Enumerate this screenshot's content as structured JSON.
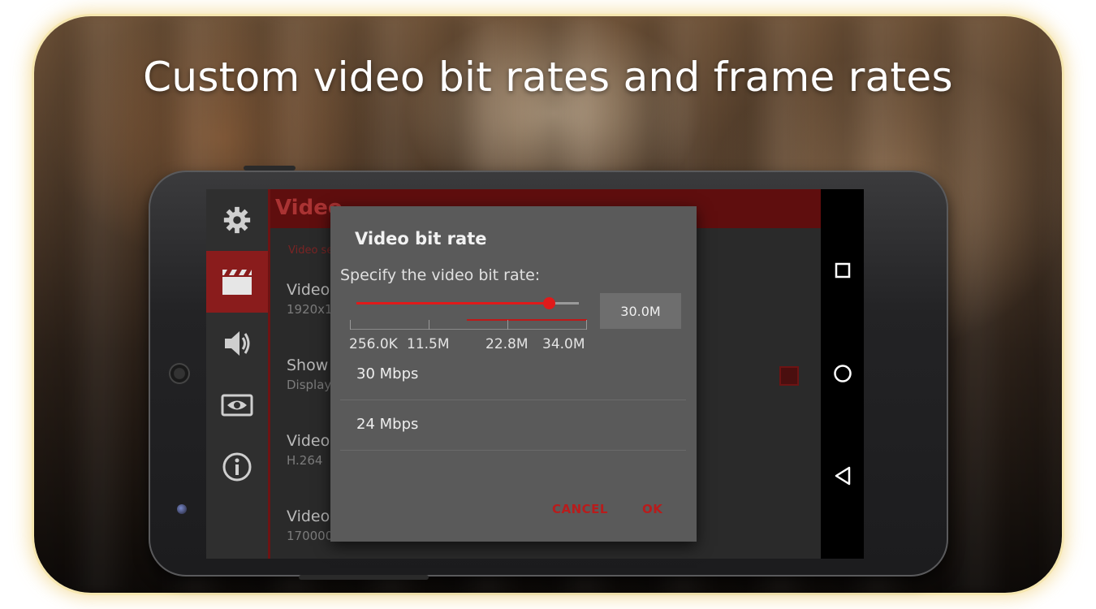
{
  "headline": "Custom video bit rates and frame rates",
  "app": {
    "sidebar": {
      "items": [
        {
          "icon": "gear-icon"
        },
        {
          "icon": "clapperboard-icon",
          "active": true
        },
        {
          "icon": "speaker-icon"
        },
        {
          "icon": "eye-icon"
        },
        {
          "icon": "info-icon"
        }
      ]
    },
    "header_title": "Video",
    "category_label": "Video se",
    "prefs": [
      {
        "title": "Video",
        "summary": "1920x1"
      },
      {
        "title": "Show",
        "summary": "Display"
      },
      {
        "title": "Video",
        "summary": "H.264"
      },
      {
        "title": "Video",
        "summary": "170000"
      }
    ]
  },
  "dialog": {
    "title": "Video bit rate",
    "message": "Specify the video bit rate:",
    "slider": {
      "value": 30.0,
      "min": 0.256,
      "max": 34.0,
      "unit": "M"
    },
    "value_button": "30.0M",
    "tick_labels": [
      "256.0K",
      "11.5M",
      "22.8M",
      "34.0M"
    ],
    "options": [
      "30 Mbps",
      "24 Mbps"
    ],
    "cancel": "CANCEL",
    "ok": "OK"
  },
  "navbar": {
    "buttons": [
      "recents-square-icon",
      "home-circle-icon",
      "back-triangle-icon"
    ]
  },
  "colors": {
    "accent": "#e01a1a",
    "header": "#5f0e0e",
    "dialog_bg": "#5a5a5a"
  }
}
